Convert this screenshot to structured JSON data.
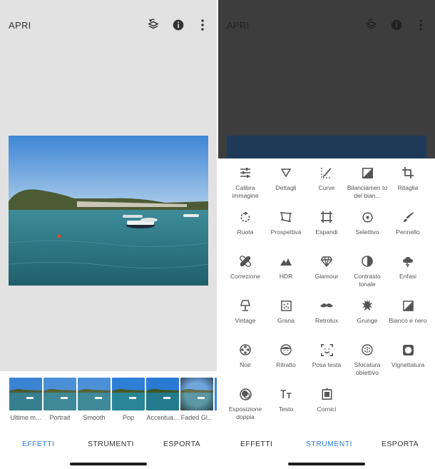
{
  "left": {
    "title": "APRI",
    "icons": [
      "history-stack-icon",
      "info-icon",
      "more-vert-icon"
    ],
    "filters": [
      "Ultime m...",
      "Portrait",
      "Smooth",
      "Pop",
      "Accentua...",
      "Faded Gl..."
    ],
    "tabs": [
      "EFFETTI",
      "STRUMENTI",
      "ESPORTA"
    ],
    "active_tab": "EFFETTI"
  },
  "right": {
    "title": "APRI",
    "tools": [
      {
        "label": "Calibra immagine",
        "icon": "sliders-icon"
      },
      {
        "label": "Dettagli",
        "icon": "triangle-down-icon"
      },
      {
        "label": "Curve",
        "icon": "curve-icon"
      },
      {
        "label": "Bilanciamen to del bian...",
        "icon": "white-balance-icon"
      },
      {
        "label": "Ritaglia",
        "icon": "crop-icon"
      },
      {
        "label": "Ruota",
        "icon": "rotate-icon"
      },
      {
        "label": "Prospettiva",
        "icon": "perspective-icon"
      },
      {
        "label": "Espandi",
        "icon": "expand-icon"
      },
      {
        "label": "Selettivo",
        "icon": "target-icon"
      },
      {
        "label": "Pennello",
        "icon": "brush-icon"
      },
      {
        "label": "Correzione",
        "icon": "bandage-icon"
      },
      {
        "label": "HDR",
        "icon": "mountain-icon"
      },
      {
        "label": "Glamour",
        "icon": "diamond-icon"
      },
      {
        "label": "Contrasto tonale",
        "icon": "contrast-icon"
      },
      {
        "label": "Enfasi",
        "icon": "cloud-bolt-icon"
      },
      {
        "label": "Vintage",
        "icon": "lamp-icon"
      },
      {
        "label": "Grana",
        "icon": "grain-icon"
      },
      {
        "label": "Retrolux",
        "icon": "mustache-icon"
      },
      {
        "label": "Grunge",
        "icon": "grunge-icon"
      },
      {
        "label": "Bianco e nero",
        "icon": "bw-icon"
      },
      {
        "label": "Noir",
        "icon": "film-reel-icon"
      },
      {
        "label": "Ritratto",
        "icon": "face-icon"
      },
      {
        "label": "Posa testa",
        "icon": "face-frame-icon"
      },
      {
        "label": "Sfocatura obiettivo",
        "icon": "lens-blur-icon"
      },
      {
        "label": "Vignettatura",
        "icon": "vignette-icon"
      },
      {
        "label": "Esposizione doppia",
        "icon": "double-exposure-icon"
      },
      {
        "label": "Testo",
        "icon": "text-icon"
      },
      {
        "label": "Cornici",
        "icon": "frame-icon"
      }
    ],
    "tabs": [
      "EFFETTI",
      "STRUMENTI",
      "ESPORTA"
    ],
    "active_tab": "STRUMENTI"
  },
  "colors": {
    "accent": "#2f7ee6",
    "icon": "#555555",
    "text": "#333333"
  }
}
